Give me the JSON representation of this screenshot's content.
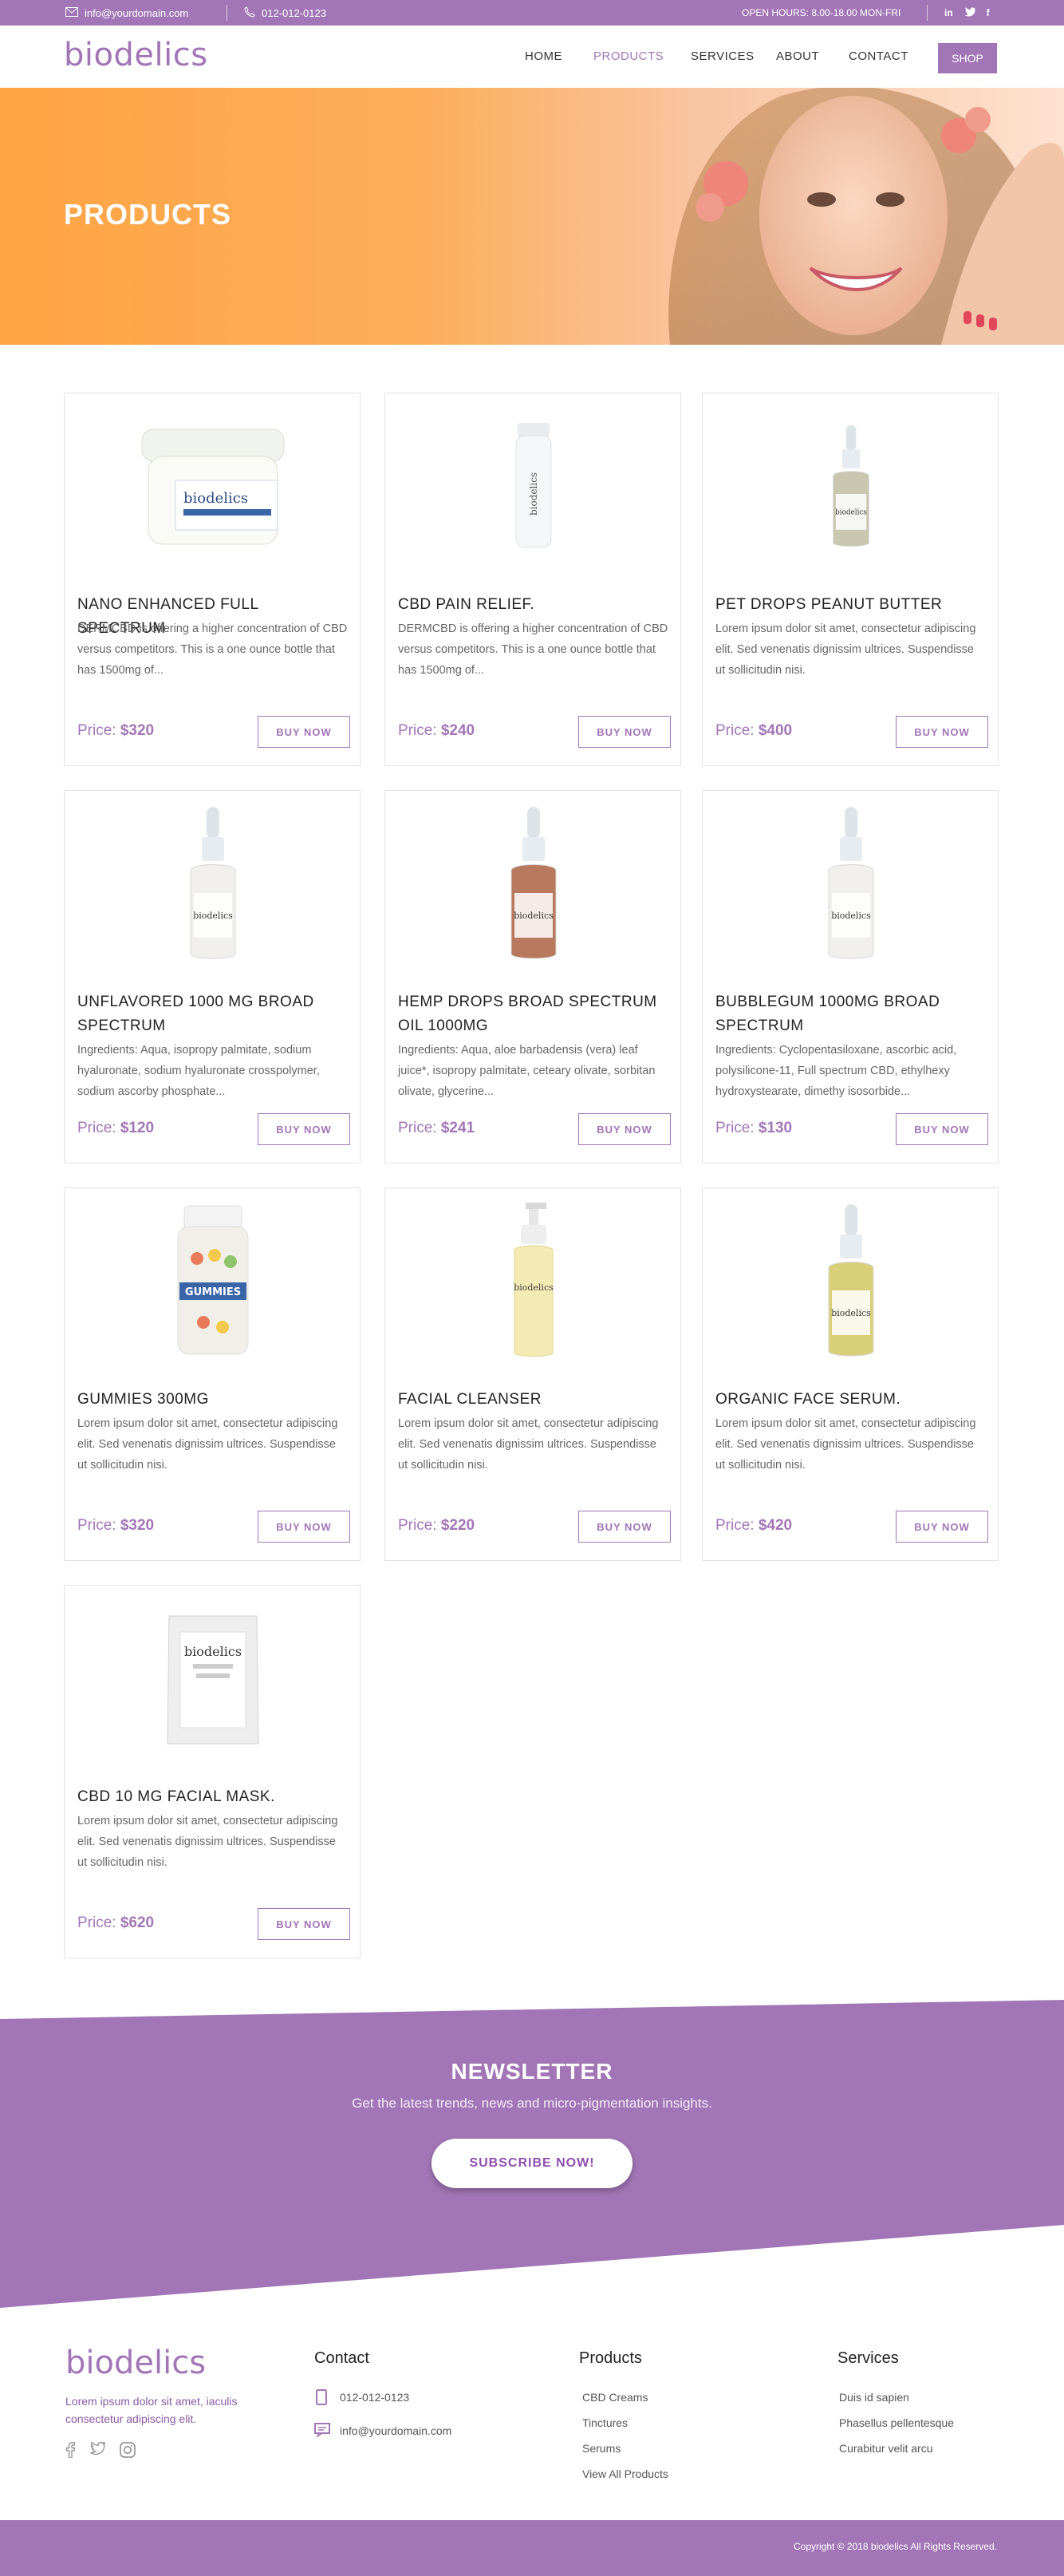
{
  "topbar": {
    "email": "info@yourdomain.com",
    "phone": "012-012-0123",
    "hours": "OPEN HOURS: 8.00-18.00 MON-FRI",
    "social": [
      "in",
      "twitter",
      "f"
    ]
  },
  "header": {
    "logo": "biodelics",
    "nav": [
      {
        "label": "HOME",
        "active": false
      },
      {
        "label": "PRODUCTS",
        "active": true
      },
      {
        "label": "SERVICES",
        "active": false
      },
      {
        "label": "ABOUT",
        "active": false
      },
      {
        "label": "CONTACT",
        "active": false
      }
    ],
    "shop_label": "SHOP"
  },
  "hero": {
    "title": "PRODUCTS"
  },
  "products": [
    {
      "name": "NANO ENHANCED FULL SPECTRUM",
      "desc": "DERMCBD is offering a higher concentration of CBD versus competitors. This is a one ounce bottle that has 1500mg of...",
      "price_label": "Price:",
      "price": "$320",
      "buy": "BUY NOW",
      "img": "jar",
      "img_text": "biodelics"
    },
    {
      "name": "CBD PAIN RELIEF.",
      "desc": "DERMCBD is offering a higher concentration of CBD versus competitors. This is a one ounce bottle that has 1500mg of...",
      "price_label": "Price:",
      "price": "$240",
      "buy": "BUY NOW",
      "img": "tube",
      "img_text": "biodelics"
    },
    {
      "name": "PET DROPS PEANUT BUTTER",
      "desc": "Lorem ipsum dolor sit amet, consectetur adipiscing elit. Sed venenatis dignissim ultrices. Suspendisse ut sollicitudin nisi.",
      "price_label": "Price:",
      "price": "$400",
      "buy": "BUY NOW",
      "img": "dropper-small",
      "img_text": "biodelics"
    },
    {
      "name": "UNFLAVORED 1000 MG BROAD SPECTRUM",
      "desc": "Ingredients: Aqua, isopropy palmitate, sodium hyaluronate, sodium hyaluronate crosspolymer, sodium ascorby phosphate...",
      "price_label": "Price:",
      "price": "$120",
      "buy": "BUY NOW",
      "img": "dropper",
      "img_text": "biodelics"
    },
    {
      "name": "HEMP DROPS BROAD SPECTRUM OIL 1000MG",
      "desc": "Ingredients: Aqua, aloe barbadensis (vera) leaf juice*, isopropy palmitate, ceteary olivate, sorbitan olivate, glycerine...",
      "price_label": "Price:",
      "price": "$241",
      "buy": "BUY NOW",
      "img": "dropper-amber",
      "img_text": "biodelics"
    },
    {
      "name": "BUBBLEGUM 1000MG BROAD SPECTRUM",
      "desc": "Ingredients: Cyclopentasiloxane, ascorbic acid, polysilicone-11, Full spectrum CBD, ethylhexy hydroxystearate, dimethy isosorbide...",
      "price_label": "Price:",
      "price": "$130",
      "buy": "BUY NOW",
      "img": "dropper",
      "img_text": "biodelics"
    },
    {
      "name": "GUMMIES 300MG",
      "desc": "Lorem ipsum dolor sit amet, consectetur adipiscing elit. Sed venenatis dignissim ultrices. Suspendisse ut sollicitudin nisi.",
      "price_label": "Price:",
      "price": "$320",
      "buy": "BUY NOW",
      "img": "gummies",
      "img_text": "GUMMIES"
    },
    {
      "name": "FACIAL CLEANSER",
      "desc": "Lorem ipsum dolor sit amet, consectetur adipiscing elit. Sed venenatis dignissim ultrices. Suspendisse ut sollicitudin nisi.",
      "price_label": "Price:",
      "price": "$220",
      "buy": "BUY NOW",
      "img": "pump",
      "img_text": "biodelics"
    },
    {
      "name": "ORGANIC FACE SERUM.",
      "desc": "Lorem ipsum dolor sit amet, consectetur adipiscing elit. Sed venenatis dignissim ultrices. Suspendisse ut sollicitudin nisi.",
      "price_label": "Price:",
      "price": "$420",
      "buy": "BUY NOW",
      "img": "dropper-green",
      "img_text": "biodelics"
    },
    {
      "name": "CBD 10 MG FACIAL MASK.",
      "desc": "Lorem ipsum dolor sit amet, consectetur adipiscing elit. Sed venenatis dignissim ultrices. Suspendisse ut sollicitudin nisi.",
      "price_label": "Price:",
      "price": "$620",
      "buy": "BUY NOW",
      "img": "pouch",
      "img_text": "biodelics"
    }
  ],
  "newsletter": {
    "title": "NEWSLETTER",
    "subtitle": "Get the latest trends, news and micro-pigmentation insights.",
    "button": "SUBSCRIBE NOW!"
  },
  "footer": {
    "logo": "biodelics",
    "about": "Lorem ipsum dolor sit amet, iaculis consectetur adipiscing elit.",
    "contact": {
      "title": "Contact",
      "phone": "012-012-0123",
      "email": "info@yourdomain.com"
    },
    "products": {
      "title": "Products",
      "links": [
        "CBD Creams",
        "Tinctures",
        "Serums",
        "View All Products"
      ]
    },
    "services": {
      "title": "Services",
      "links": [
        "Duis id sapien",
        "Phasellus pellentesque",
        "Curabitur velit arcu"
      ]
    },
    "copyright": "Copyright © 2018  biodelics  All Rights Reserved."
  },
  "colors": {
    "brand": "#a276b6",
    "hero_orange": "#fea444"
  }
}
